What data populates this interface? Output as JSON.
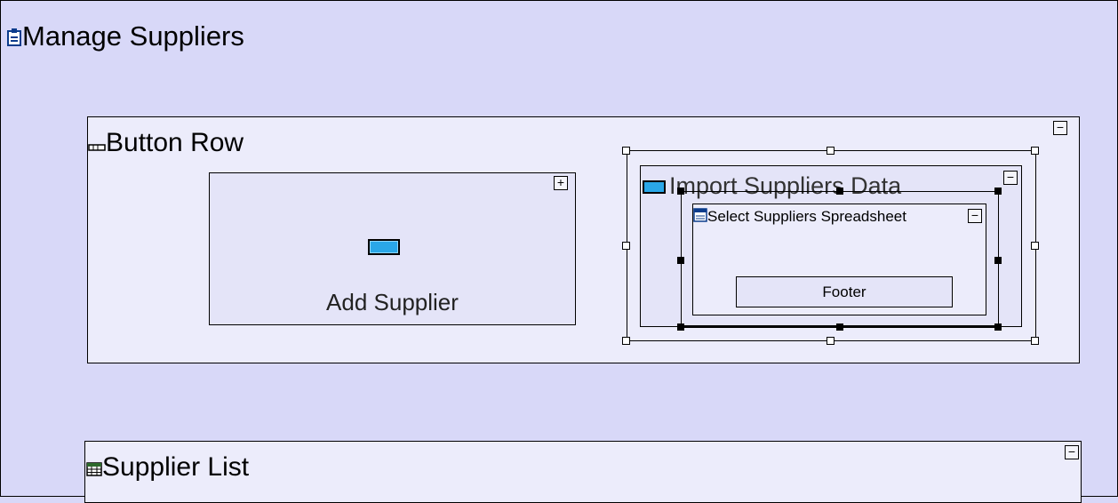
{
  "page": {
    "title": "Manage Suppliers",
    "title_icon": "form-icon"
  },
  "button_row": {
    "title": "Button Row",
    "icon": "button-row-icon",
    "collapse_label": "−",
    "add_supplier": {
      "label": "Add Supplier",
      "toggle_label": "+",
      "icon": "button-icon"
    },
    "import_suppliers": {
      "label": "Import Suppliers Data",
      "toggle_label": "−",
      "icon": "button-icon",
      "dialog": {
        "title": "Select Suppliers Spreadsheet",
        "toggle_label": "−",
        "icon": "window-icon",
        "footer_label": "Footer"
      }
    }
  },
  "supplier_list": {
    "title": "Supplier List",
    "icon": "table-icon",
    "collapse_label": "−"
  },
  "colors": {
    "background": "#d8d8f8",
    "panel": "#ececfb",
    "button_accent": "#2aa7e8"
  }
}
